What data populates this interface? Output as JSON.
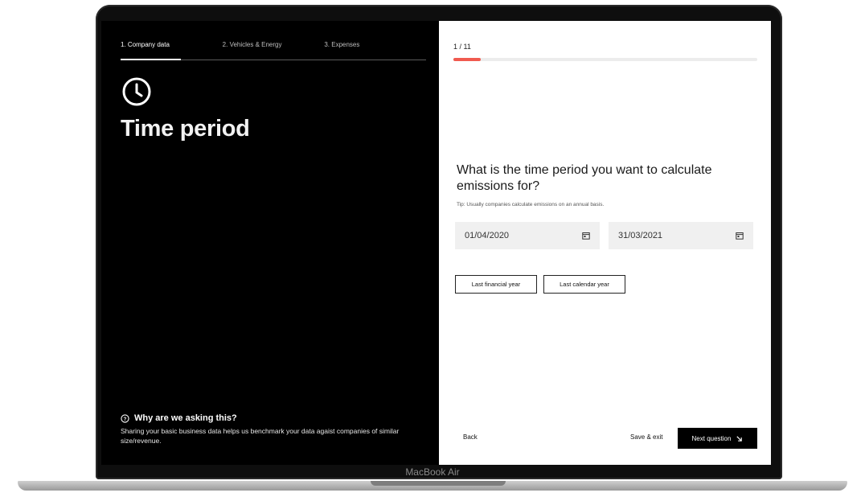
{
  "steps": [
    "1. Company data",
    "2. Vehicles & Energy",
    "3. Expenses"
  ],
  "left": {
    "title": "Time period",
    "icon": "clock-icon",
    "why_title": "Why are we asking this?",
    "why_text": "Sharing your basic business data helps us benchmark your data agaist companies of similar size/revenue."
  },
  "right": {
    "progress_text": "1 / 11",
    "progress_fraction": 0.09,
    "accent_color": "#f05a4f",
    "question": "What is the time period you want to calculate emissions for?",
    "tip": "Tip: Usually companies calculate emissions on an annual basis.",
    "start_date": "01/04/2020",
    "end_date": "31/03/2021",
    "presets": [
      "Last financial year",
      "Last calendar year"
    ],
    "back_label": "Back",
    "save_label": "Save & exit",
    "next_label": "Next question"
  },
  "device_label": "MacBook Air"
}
